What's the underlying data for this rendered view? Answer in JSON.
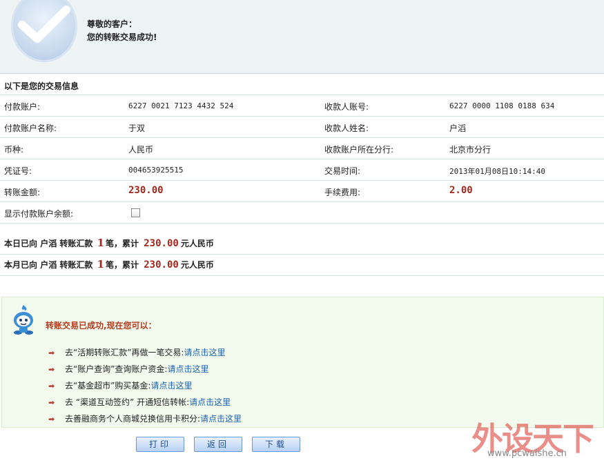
{
  "header": {
    "greeting": "尊敬的客户：",
    "message": "您的转账交易成功!"
  },
  "section_title": "以下是您的交易信息",
  "details": {
    "payer_account_label": "付款账户:",
    "payer_account": "6227 0021 7123 4432 524",
    "payee_account_label": "收款人账号:",
    "payee_account": "6227 0000 1108 0188 634",
    "payer_name_label": "付款账户名称:",
    "payer_name": "于双",
    "payee_name_label": "收款人姓名:",
    "payee_name": "户滔",
    "currency_label": "币种:",
    "currency": "人民币",
    "payee_branch_label": "收款账户所在分行:",
    "payee_branch": "北京市分行",
    "voucher_label": "凭证号:",
    "voucher": "004653925515",
    "time_label": "交易时间:",
    "time": "2013年01月08日10:14:40",
    "amount_label": "转账金额:",
    "amount": "230.00",
    "fee_label": "手续费用:",
    "fee": "2.00",
    "show_balance_label": "显示付款账户余额:"
  },
  "summary": {
    "today_prefix": "本日已向",
    "month_prefix": "本月已向",
    "payee": "户滔",
    "transfer_label": "转账汇款",
    "count": "1",
    "count_unit": "笔，累计",
    "total": "230.00",
    "currency_suffix": "元人民币"
  },
  "next_steps": {
    "title": "转账交易已成功,现在您可以：",
    "items": [
      {
        "text": "去“活期转账汇款”再做一笔交易:",
        "link": "请点击这里"
      },
      {
        "text": "去“账户查询”查询账户资金:",
        "link": "请点击这里"
      },
      {
        "text": "去“基金超市”购买基金:",
        "link": "请点击这里"
      },
      {
        "text": "去 “渠道互动签约” 开通短信转帐:",
        "link": "请点击这里"
      },
      {
        "text": "去善融商务个人商城兑换信用卡积分:",
        "link": "请点击这里"
      }
    ]
  },
  "buttons": {
    "print": "打印",
    "back": "返回",
    "download": "下载"
  },
  "watermark": {
    "text": "外设天下",
    "url": "www.pcwaishe.cn"
  },
  "colors": {
    "amount": "#a0281f",
    "link": "#1b5fa8",
    "header_bg": "#eef3f4",
    "success_bg": "#f3fbee"
  }
}
